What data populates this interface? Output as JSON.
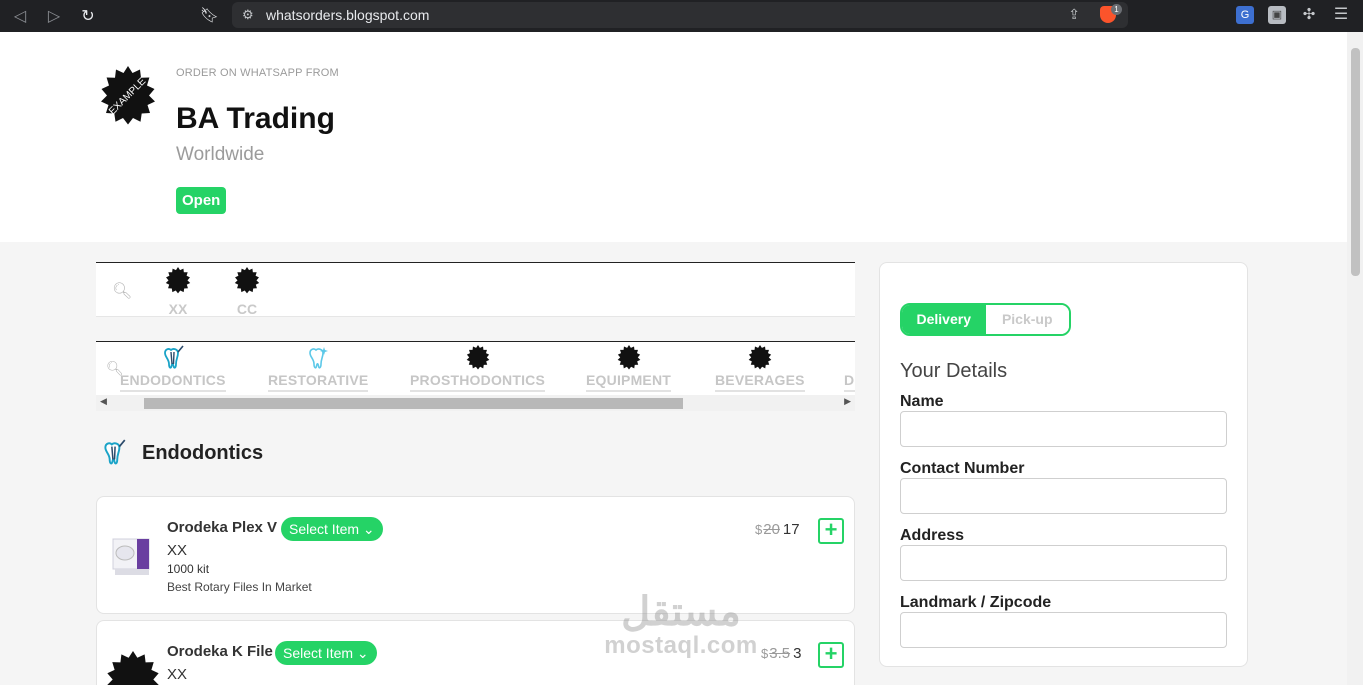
{
  "browser": {
    "url": "whatsorders.blogspot.com",
    "brave_badge": "1"
  },
  "header": {
    "logo_text": "EXAMPLE",
    "kicker": "ORDER ON WHATSAPP FROM",
    "shop_name": "BA Trading",
    "region": "Worldwide",
    "status": "Open"
  },
  "tags": [
    {
      "label": "XX"
    },
    {
      "label": "CC"
    }
  ],
  "categories": [
    {
      "label": "ENDODONTICS",
      "icon": "tooth-file-icon"
    },
    {
      "label": "RESTORATIVE",
      "icon": "tooth-sparkle-icon"
    },
    {
      "label": "PROSTHODONTICS",
      "icon": "example-badge-icon"
    },
    {
      "label": "EQUIPMENT",
      "icon": "example-badge-icon"
    },
    {
      "label": "BEVERAGES",
      "icon": "example-badge-icon"
    },
    {
      "label": "DI",
      "icon": "example-badge-icon"
    }
  ],
  "section": {
    "title": "Endodontics"
  },
  "products": [
    {
      "name": "Orodeka Plex V",
      "select_label": "Select Item",
      "variant": "XX",
      "qty": "1000 kit",
      "description": "Best Rotary Files In Market",
      "currency": "$",
      "old_price": "20",
      "price": "17"
    },
    {
      "name": "Orodeka K File",
      "select_label": "Select Item",
      "variant": "XX",
      "qty": "",
      "description": "",
      "currency": "$",
      "old_price": "3.5",
      "price": "3"
    }
  ],
  "checkout": {
    "delivery_label": "Delivery",
    "pickup_label": "Pick-up",
    "selected_mode": "Delivery",
    "heading": "Your Details",
    "fields": [
      {
        "label": "Name",
        "value": ""
      },
      {
        "label": "Contact Number",
        "value": ""
      },
      {
        "label": "Address",
        "value": ""
      },
      {
        "label": "Landmark / Zipcode",
        "value": ""
      }
    ]
  },
  "watermark": {
    "arabic": "مستقل",
    "latin": "mostaql.com"
  },
  "colors": {
    "accent": "#25d366",
    "chrome": "#202124"
  }
}
